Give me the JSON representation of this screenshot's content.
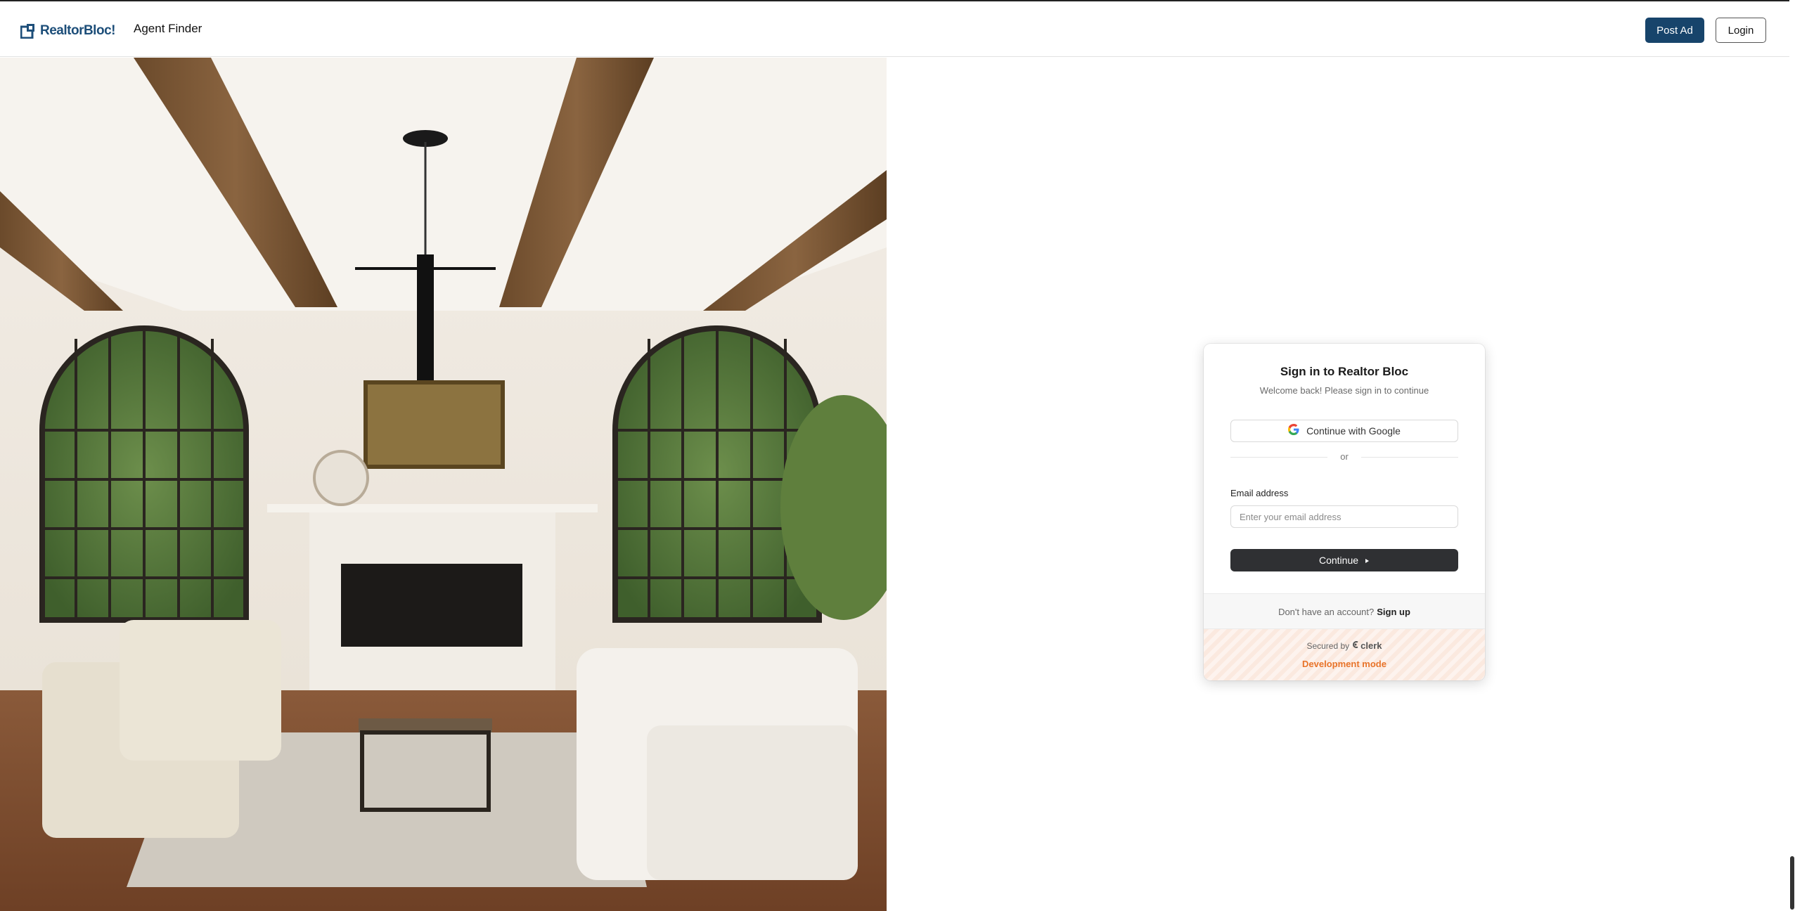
{
  "header": {
    "brand": "RealtorBloc!",
    "nav_link": "Agent Finder",
    "post_ad": "Post Ad",
    "login": "Login"
  },
  "hero": {
    "description": "living room with wooden beams, arched windows, fireplace, armchairs and sofa"
  },
  "signin": {
    "title": "Sign in to Realtor Bloc",
    "subtitle": "Welcome back! Please sign in to continue",
    "google_button": "Continue with Google",
    "divider": "or",
    "email_label": "Email address",
    "email_placeholder": "Enter your email address",
    "email_value": "",
    "continue_button": "Continue",
    "no_account": "Don't have an account?",
    "sign_up": "Sign up",
    "secured_by": "Secured by",
    "secured_brand": "clerk",
    "dev_mode": "Development mode"
  },
  "colors": {
    "brand": "#1d4e79",
    "post_ad_bg": "#17446b",
    "continue_bg": "#2f3033",
    "dev_mode": "#e8742a"
  }
}
